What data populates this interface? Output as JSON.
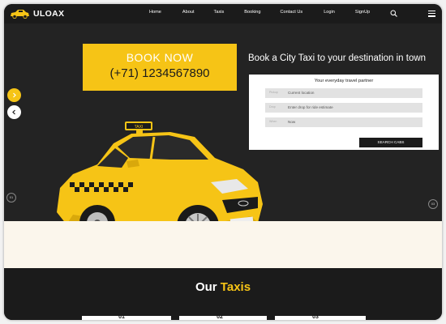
{
  "brand": {
    "name": "ULOAX"
  },
  "nav": {
    "items": [
      "Home",
      "About",
      "Taxis",
      "Booking",
      "Contact Us",
      "Login",
      "SignUp"
    ]
  },
  "hero": {
    "book_now": "BOOK NOW",
    "phone": "(+71) 1234567890",
    "heading": "Book a City Taxi to your destination in town"
  },
  "form": {
    "title": "Your everyday travel partner",
    "fields": [
      {
        "label": "Pickup",
        "value": "Current location"
      },
      {
        "label": "Drop",
        "value": "Enter drop for ride estimate"
      },
      {
        "label": "When",
        "value": "Now"
      }
    ],
    "button": "SEARCH CABS"
  },
  "slider": {
    "left_dot": "01",
    "right_dot": "03"
  },
  "taxis": {
    "title_part1": "Our ",
    "title_part2": "Taxis",
    "cards": [
      "01",
      "02",
      "03"
    ]
  },
  "colors": {
    "accent": "#f6c416",
    "dark": "#1b1b1b",
    "cream": "#fbf6ec"
  },
  "icons": {
    "logo": "taxi-car-icon",
    "search": "search-icon",
    "menu": "hamburger-menu-icon",
    "next": "chevron-right-icon",
    "prev": "chevron-left-icon"
  }
}
